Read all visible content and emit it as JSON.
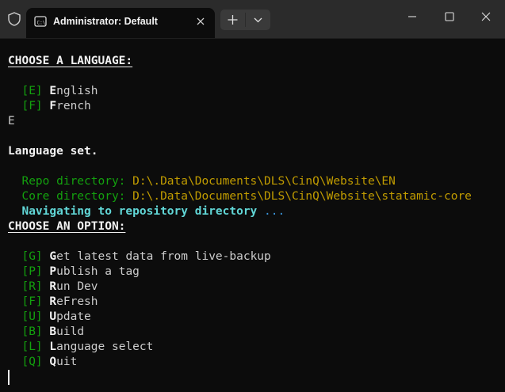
{
  "window": {
    "tab_title": "Administrator: Default",
    "tab_icon": "terminal-icon",
    "shield_icon": "shield-icon",
    "new_tab_icon": "plus-icon",
    "dropdown_icon": "chevron-down-icon"
  },
  "colors": {
    "background": "#0c0c0c",
    "titlebar": "#2b2b2b",
    "green": "#13a10e",
    "yellow": "#c19c00",
    "cyan": "#61d6d6",
    "white": "#f2f2f2"
  },
  "terminal": {
    "lang_header": "CHOOSE A LANGUAGE:",
    "lang_options": [
      {
        "key": "[E]",
        "first": "E",
        "rest": "nglish"
      },
      {
        "key": "[F]",
        "first": "F",
        "rest": "rench"
      }
    ],
    "input_echo": "E",
    "language_set": "Language set.",
    "repo_label": "Repo directory:",
    "repo_path": "D:\\.Data\\Documents\\DLS\\CinQ\\Website\\EN",
    "core_label": "Core directory:",
    "core_path": "D:\\.Data\\Documents\\DLS\\CinQ\\Website\\statamic-core",
    "navigating": "Navigating to repository directory",
    "ellipsis": "...",
    "option_header": "CHOOSE AN OPTION:",
    "options": [
      {
        "key": "[G]",
        "first": "G",
        "rest": "et latest data from live-backup"
      },
      {
        "key": "[P]",
        "first": "P",
        "rest": "ublish a tag"
      },
      {
        "key": "[R]",
        "first": "R",
        "rest": "un Dev"
      },
      {
        "key": "[F]",
        "first": "R",
        "rest": "eFresh"
      },
      {
        "key": "[U]",
        "first": "U",
        "rest": "pdate"
      },
      {
        "key": "[B]",
        "first": "B",
        "rest": "uild"
      },
      {
        "key": "[L]",
        "first": "L",
        "rest": "anguage select"
      },
      {
        "key": "[Q]",
        "first": "Q",
        "rest": "uit"
      }
    ]
  }
}
